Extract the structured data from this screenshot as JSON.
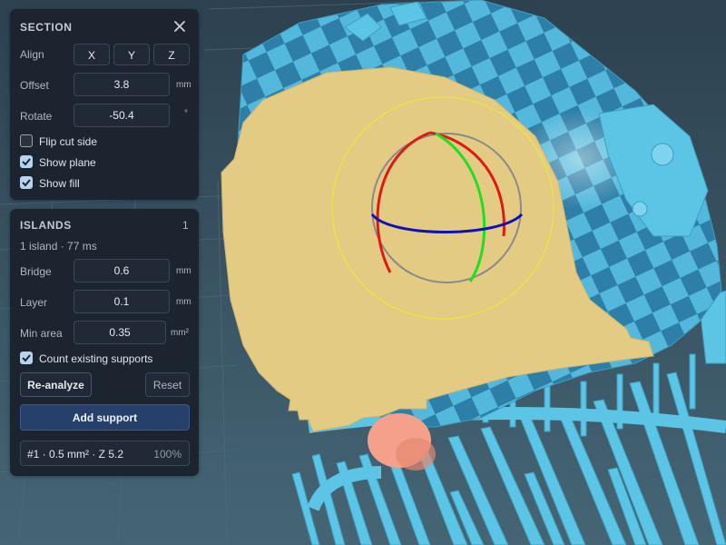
{
  "section": {
    "title": "SECTION",
    "close_icon": "close-icon",
    "align_label": "Align",
    "align_buttons": [
      "X",
      "Y",
      "Z"
    ],
    "offset_label": "Offset",
    "offset_value": "3.8",
    "offset_unit": "mm",
    "rotate_label": "Rotate",
    "rotate_value": "-50.4",
    "rotate_unit": "°",
    "flip_cut_side": {
      "label": "Flip cut side",
      "checked": false
    },
    "show_plane": {
      "label": "Show plane",
      "checked": true
    },
    "show_fill": {
      "label": "Show fill",
      "checked": true
    }
  },
  "islands": {
    "title": "ISLANDS",
    "count": "1",
    "summary": "1 island · 77 ms",
    "bridge_label": "Bridge",
    "bridge_value": "0.6",
    "bridge_unit": "mm",
    "layer_label": "Layer",
    "layer_value": "0.1",
    "layer_unit": "mm",
    "min_area_label": "Min area",
    "min_area_value": "0.35",
    "min_area_unit": "mm²",
    "count_existing": {
      "label": "Count existing supports",
      "checked": true
    },
    "reanalyze_label": "Re-analyze",
    "reset_label": "Reset",
    "add_support_label": "Add support",
    "result_item": {
      "label": "#1 · 0.5 mm² · Z 5.2",
      "percent": "100%"
    }
  },
  "colors": {
    "background": "#3b5566",
    "panel": "#1c2430",
    "model": "#5cc4e4",
    "section_fill": "#e3cb84",
    "gizmo_x": "#e01818",
    "gizmo_y": "#22dd22",
    "gizmo_z": "#1010b8",
    "gizmo_ring": "#e8e34a",
    "island_highlight": "#f4a08a",
    "accent_button": "#26406b"
  }
}
